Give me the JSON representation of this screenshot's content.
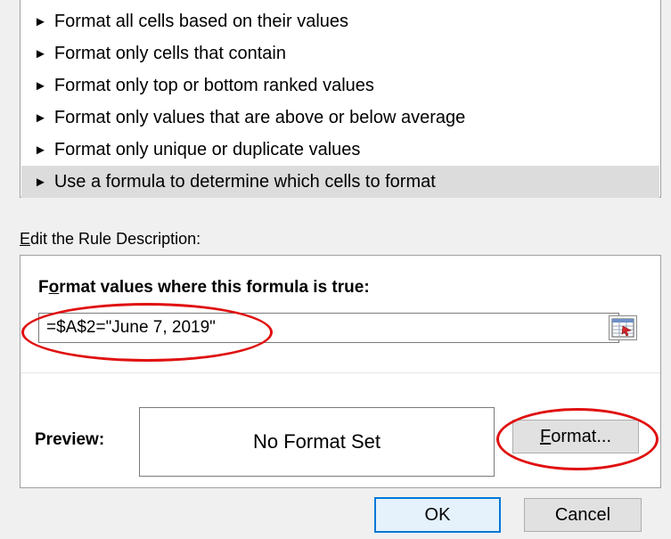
{
  "rule_types": [
    {
      "label": "Format all cells based on their values"
    },
    {
      "label": "Format only cells that contain"
    },
    {
      "label": "Format only top or bottom ranked values"
    },
    {
      "label": "Format only values that are above or below average"
    },
    {
      "label": "Format only unique or duplicate values"
    },
    {
      "label": "Use a formula to determine which cells to format"
    }
  ],
  "selected_rule_index": 5,
  "arrow_glyph": "►",
  "edit_section": {
    "label_mnemonic": "E",
    "label_rest": "dit the Rule Description:"
  },
  "formula_section": {
    "heading_pre": "F",
    "heading_mnemonic": "o",
    "heading_rest": "rmat values where this formula is true:",
    "value": "=$A$2=\"June 7, 2019\""
  },
  "preview": {
    "label": "Preview:",
    "text": "No Format Set"
  },
  "format_button": {
    "mnemonic": "F",
    "rest": "ormat..."
  },
  "ok_label": "OK",
  "cancel_label": "Cancel",
  "colors": {
    "annotation": "#e01010",
    "ok_border": "#0078d7",
    "selected_row": "#dcdcdc"
  },
  "icons": {
    "range_selector": "collapse-dialog-icon"
  }
}
